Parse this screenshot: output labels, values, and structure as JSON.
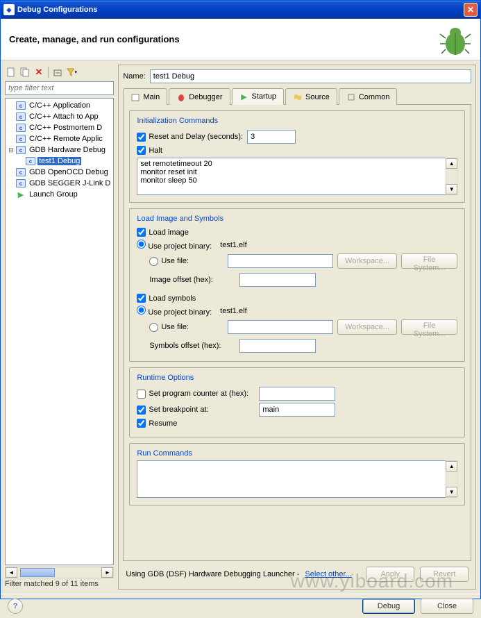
{
  "titlebar": {
    "title": "Debug Configurations"
  },
  "header": {
    "title": "Create, manage, and run configurations"
  },
  "left": {
    "filter_placeholder": "type filter text",
    "tree": [
      {
        "label": "C/C++ Application",
        "icon": "c"
      },
      {
        "label": "C/C++ Attach to App",
        "icon": "c"
      },
      {
        "label": "C/C++ Postmortem D",
        "icon": "c"
      },
      {
        "label": "C/C++ Remote Applic",
        "icon": "c"
      },
      {
        "label": "GDB Hardware Debug",
        "icon": "c",
        "expanded": true,
        "children": [
          {
            "label": "test1 Debug",
            "icon": "c",
            "selected": true
          }
        ]
      },
      {
        "label": "GDB OpenOCD Debug",
        "icon": "c"
      },
      {
        "label": "GDB SEGGER J-Link D",
        "icon": "c"
      },
      {
        "label": "Launch Group",
        "icon": "arrow"
      }
    ],
    "status": "Filter matched 9 of 11 items"
  },
  "right": {
    "name_label": "Name:",
    "name_value": "test1 Debug",
    "tabs": [
      {
        "label": "Main"
      },
      {
        "label": "Debugger"
      },
      {
        "label": "Startup",
        "active": true
      },
      {
        "label": "Source"
      },
      {
        "label": "Common"
      }
    ],
    "init": {
      "legend": "Initialization Commands",
      "reset_label": "Reset and Delay (seconds):",
      "reset_checked": true,
      "delay_value": "3",
      "halt_label": "Halt",
      "halt_checked": true,
      "commands": "set remotetimeout 20\nmonitor reset init\nmonitor sleep 50"
    },
    "load": {
      "legend": "Load Image and Symbols",
      "load_image_label": "Load image",
      "load_image_checked": true,
      "use_project_binary_label": "Use project binary:",
      "project_binary_value": "test1.elf",
      "use_file_label": "Use file:",
      "workspace_btn": "Workspace...",
      "filesystem_btn": "File System...",
      "image_offset_label": "Image offset (hex):",
      "image_offset_value": "",
      "load_symbols_label": "Load symbols",
      "load_symbols_checked": true,
      "symbols_project_binary_value": "test1.elf",
      "symbols_offset_label": "Symbols offset (hex):",
      "symbols_offset_value": ""
    },
    "runtime": {
      "legend": "Runtime Options",
      "set_pc_label": "Set program counter at (hex):",
      "set_pc_checked": false,
      "set_pc_value": "",
      "set_bp_label": "Set breakpoint at:",
      "set_bp_checked": true,
      "set_bp_value": "main",
      "resume_label": "Resume",
      "resume_checked": true
    },
    "run": {
      "legend": "Run Commands",
      "commands": ""
    },
    "footer": {
      "launcher_text": "Using GDB (DSF) Hardware Debugging Launcher - ",
      "select_other": "Select other...",
      "apply": "Apply",
      "revert": "Revert"
    }
  },
  "bottom": {
    "debug": "Debug",
    "close": "Close"
  },
  "watermark": "www.yiboard.com"
}
